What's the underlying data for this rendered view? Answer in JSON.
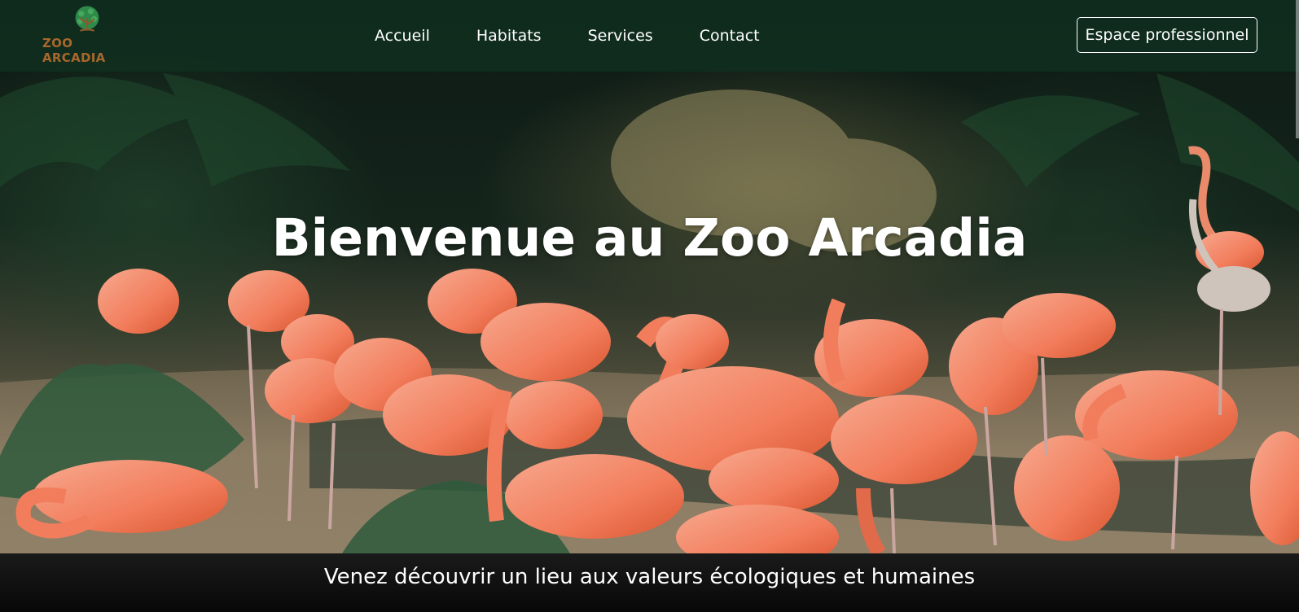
{
  "brand": {
    "name": "ZOO ARCADIA",
    "logo_icon": "tree-icon",
    "logo_color": "#a8672b"
  },
  "nav": {
    "links": [
      {
        "label": "Accueil"
      },
      {
        "label": "Habitats"
      },
      {
        "label": "Services"
      },
      {
        "label": "Contact"
      }
    ],
    "pro_button_label": "Espace professionnel"
  },
  "hero": {
    "title": "Bienvenue au Zoo Arcadia",
    "image_subject": "flamingo-flock"
  },
  "tagline": "Venez découvrir un lieu aux valeurs écologiques et humaines",
  "colors": {
    "navbar": "#103020",
    "flamingo": "#f08060",
    "text": "#ffffff"
  }
}
